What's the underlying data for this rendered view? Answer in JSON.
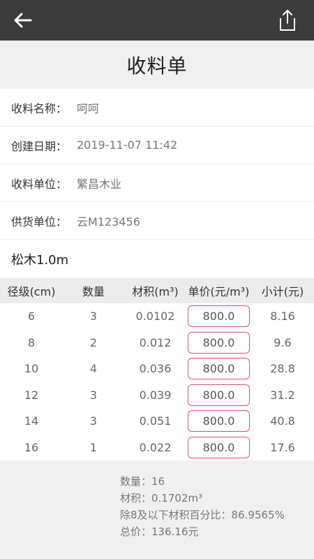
{
  "header": {
    "back_icon": "arrow-left-icon",
    "share_icon": "share-icon"
  },
  "page_title": "收料单",
  "info": {
    "name_label": "收料名称：",
    "name_value": "呵呵",
    "date_label": "创建日期：",
    "date_value": "2019-11-07 11:42",
    "unit_label": "收料单位：",
    "unit_value": "繁昌木业",
    "supplier_label": "供货单位：",
    "supplier_value": "云M123456"
  },
  "section_title": "松木1.0m",
  "table": {
    "headers": [
      "径级(cm)",
      "数量",
      "材积(m³)",
      "单价(元/m³)",
      "小计(元)"
    ],
    "rows": [
      {
        "grade": "6",
        "qty": "3",
        "volume": "0.0102",
        "price": "800.0",
        "subtotal": "8.16"
      },
      {
        "grade": "8",
        "qty": "2",
        "volume": "0.012",
        "price": "800.0",
        "subtotal": "9.6"
      },
      {
        "grade": "10",
        "qty": "4",
        "volume": "0.036",
        "price": "800.0",
        "subtotal": "28.8"
      },
      {
        "grade": "12",
        "qty": "3",
        "volume": "0.039",
        "price": "800.0",
        "subtotal": "31.2"
      },
      {
        "grade": "14",
        "qty": "3",
        "volume": "0.051",
        "price": "800.0",
        "subtotal": "40.8"
      },
      {
        "grade": "16",
        "qty": "1",
        "volume": "0.022",
        "price": "800.0",
        "subtotal": "17.6"
      }
    ]
  },
  "summary": {
    "quantity": "数量：16",
    "volume": "材积：0.1702m³",
    "percent": "除8及以下材积百分比：86.9565%",
    "total": "总价：136.16元"
  },
  "colors": {
    "topbar": "#3b3b3b",
    "accent_border": "#d6527c"
  }
}
